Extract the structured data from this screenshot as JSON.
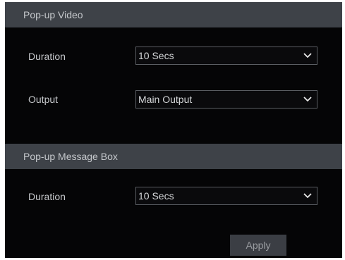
{
  "popup_video": {
    "header": "Pop-up Video",
    "duration_label": "Duration",
    "duration_value": "10 Secs",
    "output_label": "Output",
    "output_value": "Main Output"
  },
  "popup_message_box": {
    "header": "Pop-up Message Box",
    "duration_label": "Duration",
    "duration_value": "10 Secs"
  },
  "actions": {
    "apply_label": "Apply"
  },
  "icons": {
    "dropdown": "chevron-down-icon"
  },
  "colors": {
    "panel_background": "#050506",
    "section_header": "#3e4248",
    "text": "#c7c9cc",
    "select_border": "#5a5d62",
    "button": "#3b3e44"
  }
}
